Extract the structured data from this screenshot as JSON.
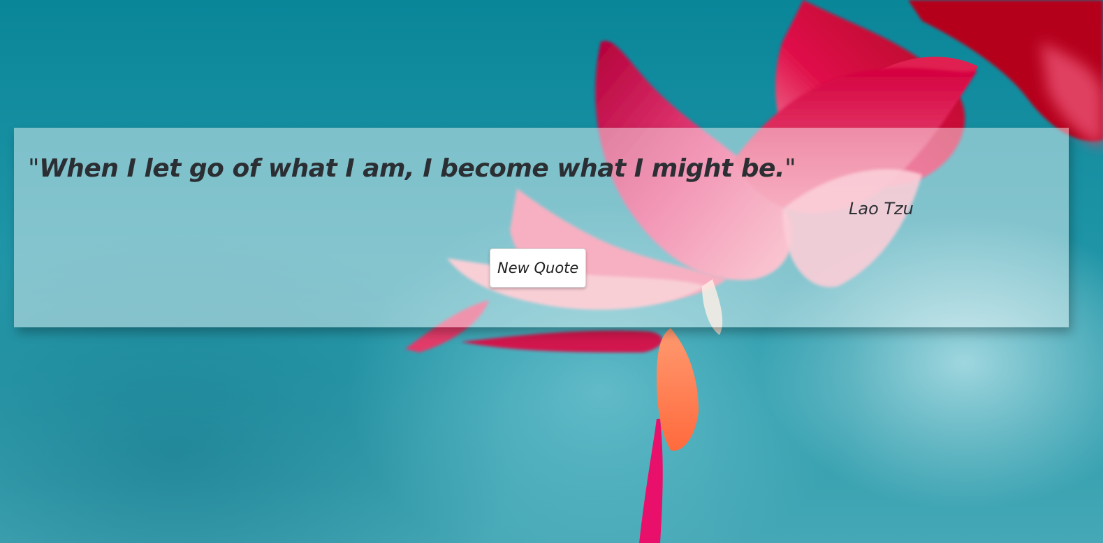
{
  "quote": {
    "open_mark": "\"",
    "text": "When I let go of what I am, I become what I might be.",
    "close_mark": "\"",
    "author": "Lao Tzu"
  },
  "controls": {
    "new_quote_label": "New Quote"
  },
  "colors": {
    "background_teal": "#0a8699",
    "flower_pink": "#e8407a",
    "flower_red": "#c8102e",
    "text": "#2b2f33",
    "panel": "rgba(255,255,255,0.45)"
  }
}
